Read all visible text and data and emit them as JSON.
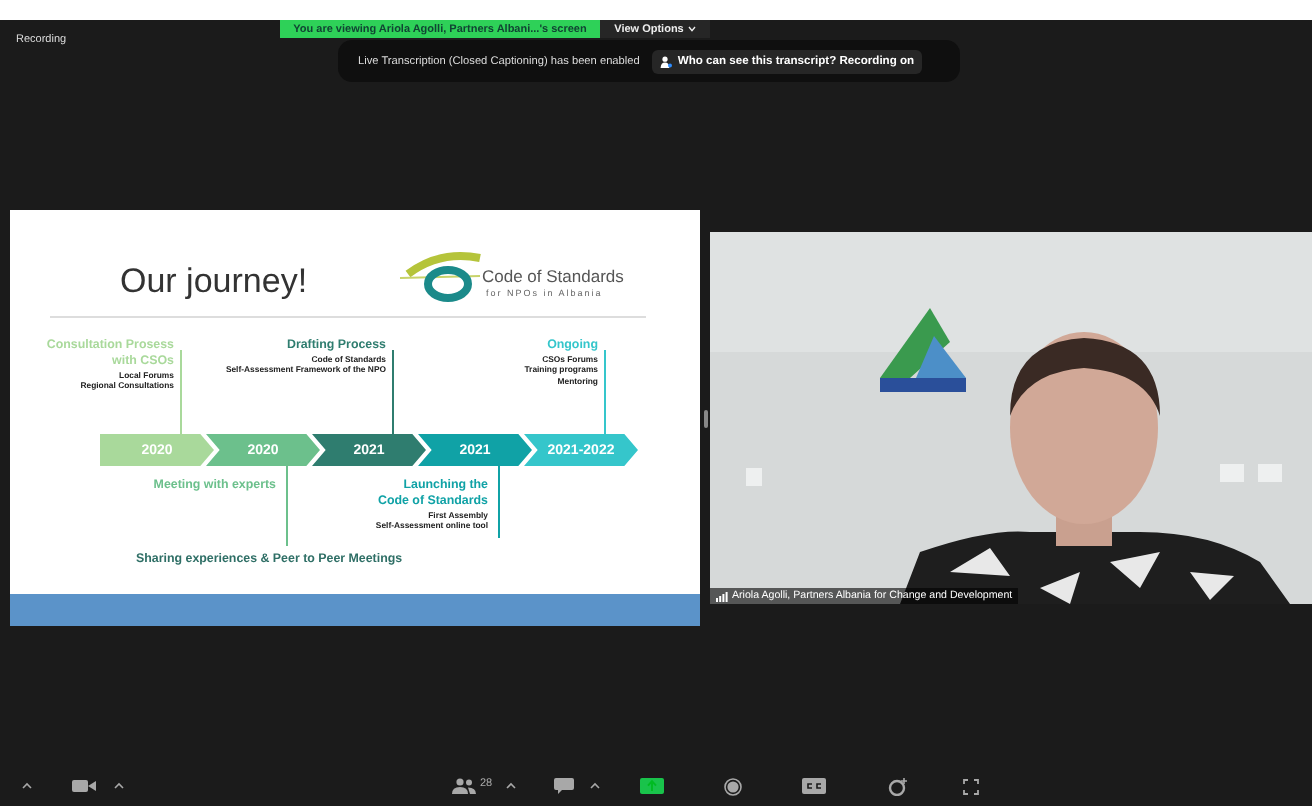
{
  "recording_label": "Recording",
  "top_banner": {
    "text": "You are viewing Ariola Agolli, Partners Albani...'s screen",
    "view_options": "View Options"
  },
  "notification": {
    "text": "Live Transcription (Closed Captioning) has been enabled",
    "button": "Who can see this transcript? Recording on"
  },
  "slide": {
    "title": "Our journey!",
    "logo": {
      "title": "Code of Standards",
      "subtitle": "for NPOs in Albania"
    },
    "timeline": [
      {
        "year": "2020",
        "color": "#a9d99b",
        "milestone": {
          "kind": "above",
          "title": "Consultation Prosess\nwith CSOs",
          "items": [
            "Local Forums",
            "Regional Consultations"
          ]
        }
      },
      {
        "year": "2020",
        "color": "#6cc08c",
        "milestone": {
          "kind": "below",
          "title": "Meeting with experts"
        }
      },
      {
        "year": "2021",
        "color": "#2f7d6f",
        "milestone": {
          "kind": "above",
          "title": "Drafting Process",
          "items": [
            "Code of Standards",
            "Self-Assessment Framework of the NPO"
          ]
        }
      },
      {
        "year": "2021",
        "color": "#10a2a6",
        "milestone": {
          "kind": "below",
          "title": "Launching the\nCode of Standards",
          "items": [
            "First Assembly",
            "Self-Assessment online tool"
          ]
        }
      },
      {
        "year": "2021-2022",
        "color": "#35c6cb",
        "milestone": {
          "kind": "above",
          "title": "Ongoing",
          "items": [
            "CSOs Forums",
            "Training programs",
            "Mentoring"
          ]
        }
      }
    ],
    "footer_note": "Sharing experiences & Peer to Peer Meetings"
  },
  "video": {
    "kind": "picture",
    "participant_name": "Ariola Agolli, Partners Albania for Change and Development"
  },
  "toolbar": {
    "participants_count": "28"
  }
}
